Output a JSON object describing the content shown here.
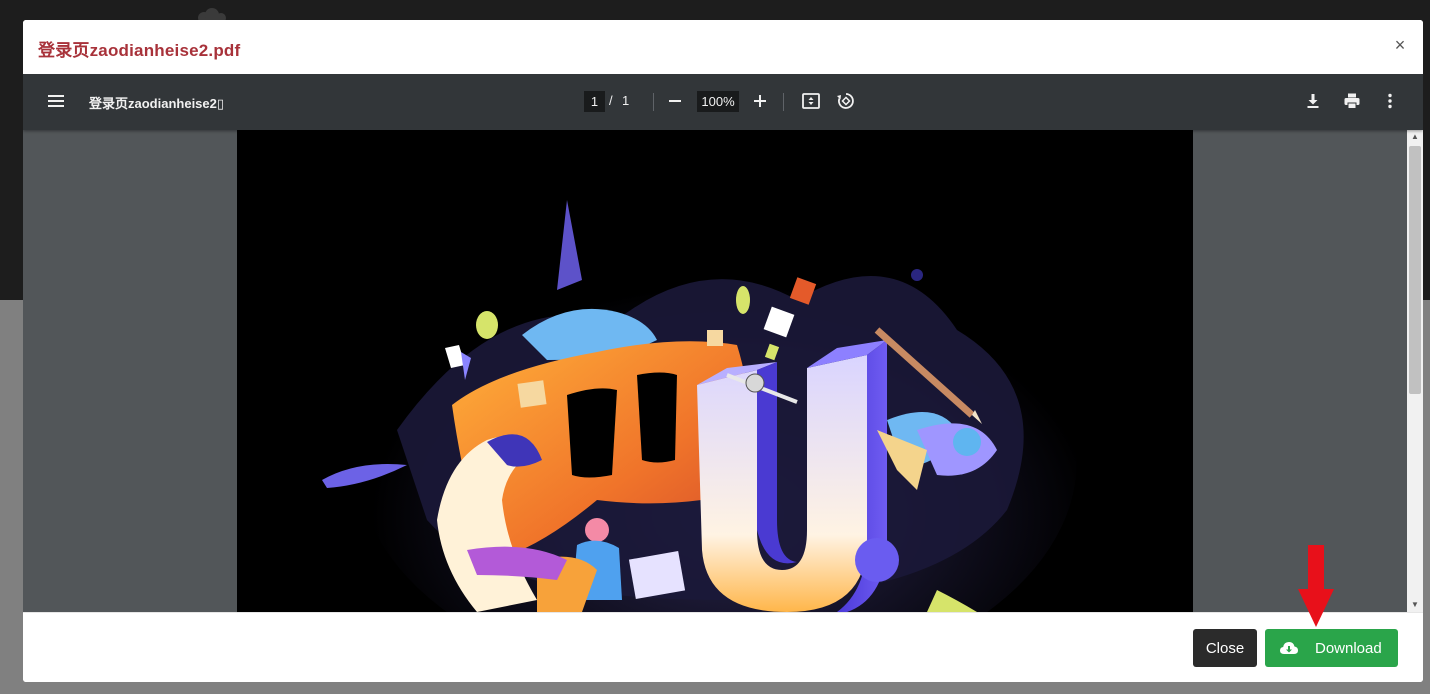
{
  "modal": {
    "title": "登录页zaodianheise2.pdf",
    "close_glyph": "×"
  },
  "pdf_viewer": {
    "file_name": "登录页zaodianheise2▯",
    "current_page": "1",
    "page_separator": "/",
    "total_pages": "1",
    "zoom": "100%",
    "icons": [
      "menu-icon",
      "zoom-out-icon",
      "zoom-in-icon",
      "fit-page-icon",
      "rotate-icon",
      "download-icon",
      "print-icon",
      "more-options-icon"
    ]
  },
  "footer": {
    "close_label": "Close",
    "download_label": "Download"
  },
  "colors": {
    "title": "#a8323a",
    "toolbar": "#323639",
    "viewer_bg": "#525659",
    "download_button": "#2aa54a",
    "close_button": "#2b2b2b",
    "annotation_arrow": "#e8101a"
  }
}
